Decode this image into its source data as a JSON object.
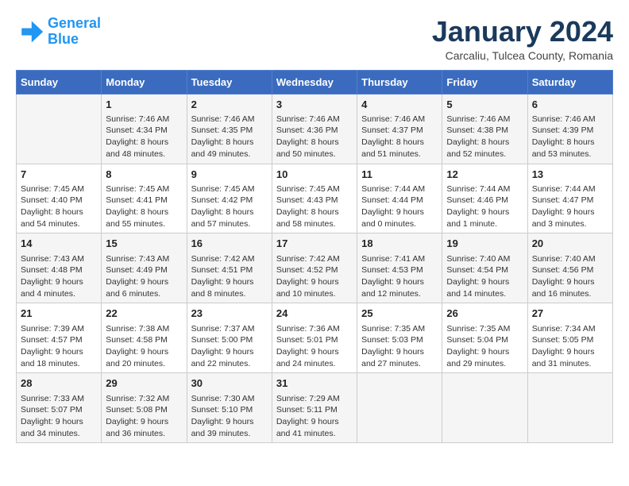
{
  "header": {
    "logo_line1": "General",
    "logo_line2": "Blue",
    "month_title": "January 2024",
    "location": "Carcaliu, Tulcea County, Romania"
  },
  "weekdays": [
    "Sunday",
    "Monday",
    "Tuesday",
    "Wednesday",
    "Thursday",
    "Friday",
    "Saturday"
  ],
  "weeks": [
    [
      {
        "day": "",
        "info": ""
      },
      {
        "day": "1",
        "info": "Sunrise: 7:46 AM\nSunset: 4:34 PM\nDaylight: 8 hours\nand 48 minutes."
      },
      {
        "day": "2",
        "info": "Sunrise: 7:46 AM\nSunset: 4:35 PM\nDaylight: 8 hours\nand 49 minutes."
      },
      {
        "day": "3",
        "info": "Sunrise: 7:46 AM\nSunset: 4:36 PM\nDaylight: 8 hours\nand 50 minutes."
      },
      {
        "day": "4",
        "info": "Sunrise: 7:46 AM\nSunset: 4:37 PM\nDaylight: 8 hours\nand 51 minutes."
      },
      {
        "day": "5",
        "info": "Sunrise: 7:46 AM\nSunset: 4:38 PM\nDaylight: 8 hours\nand 52 minutes."
      },
      {
        "day": "6",
        "info": "Sunrise: 7:46 AM\nSunset: 4:39 PM\nDaylight: 8 hours\nand 53 minutes."
      }
    ],
    [
      {
        "day": "7",
        "info": "Sunrise: 7:45 AM\nSunset: 4:40 PM\nDaylight: 8 hours\nand 54 minutes."
      },
      {
        "day": "8",
        "info": "Sunrise: 7:45 AM\nSunset: 4:41 PM\nDaylight: 8 hours\nand 55 minutes."
      },
      {
        "day": "9",
        "info": "Sunrise: 7:45 AM\nSunset: 4:42 PM\nDaylight: 8 hours\nand 57 minutes."
      },
      {
        "day": "10",
        "info": "Sunrise: 7:45 AM\nSunset: 4:43 PM\nDaylight: 8 hours\nand 58 minutes."
      },
      {
        "day": "11",
        "info": "Sunrise: 7:44 AM\nSunset: 4:44 PM\nDaylight: 9 hours\nand 0 minutes."
      },
      {
        "day": "12",
        "info": "Sunrise: 7:44 AM\nSunset: 4:46 PM\nDaylight: 9 hours\nand 1 minute."
      },
      {
        "day": "13",
        "info": "Sunrise: 7:44 AM\nSunset: 4:47 PM\nDaylight: 9 hours\nand 3 minutes."
      }
    ],
    [
      {
        "day": "14",
        "info": "Sunrise: 7:43 AM\nSunset: 4:48 PM\nDaylight: 9 hours\nand 4 minutes."
      },
      {
        "day": "15",
        "info": "Sunrise: 7:43 AM\nSunset: 4:49 PM\nDaylight: 9 hours\nand 6 minutes."
      },
      {
        "day": "16",
        "info": "Sunrise: 7:42 AM\nSunset: 4:51 PM\nDaylight: 9 hours\nand 8 minutes."
      },
      {
        "day": "17",
        "info": "Sunrise: 7:42 AM\nSunset: 4:52 PM\nDaylight: 9 hours\nand 10 minutes."
      },
      {
        "day": "18",
        "info": "Sunrise: 7:41 AM\nSunset: 4:53 PM\nDaylight: 9 hours\nand 12 minutes."
      },
      {
        "day": "19",
        "info": "Sunrise: 7:40 AM\nSunset: 4:54 PM\nDaylight: 9 hours\nand 14 minutes."
      },
      {
        "day": "20",
        "info": "Sunrise: 7:40 AM\nSunset: 4:56 PM\nDaylight: 9 hours\nand 16 minutes."
      }
    ],
    [
      {
        "day": "21",
        "info": "Sunrise: 7:39 AM\nSunset: 4:57 PM\nDaylight: 9 hours\nand 18 minutes."
      },
      {
        "day": "22",
        "info": "Sunrise: 7:38 AM\nSunset: 4:58 PM\nDaylight: 9 hours\nand 20 minutes."
      },
      {
        "day": "23",
        "info": "Sunrise: 7:37 AM\nSunset: 5:00 PM\nDaylight: 9 hours\nand 22 minutes."
      },
      {
        "day": "24",
        "info": "Sunrise: 7:36 AM\nSunset: 5:01 PM\nDaylight: 9 hours\nand 24 minutes."
      },
      {
        "day": "25",
        "info": "Sunrise: 7:35 AM\nSunset: 5:03 PM\nDaylight: 9 hours\nand 27 minutes."
      },
      {
        "day": "26",
        "info": "Sunrise: 7:35 AM\nSunset: 5:04 PM\nDaylight: 9 hours\nand 29 minutes."
      },
      {
        "day": "27",
        "info": "Sunrise: 7:34 AM\nSunset: 5:05 PM\nDaylight: 9 hours\nand 31 minutes."
      }
    ],
    [
      {
        "day": "28",
        "info": "Sunrise: 7:33 AM\nSunset: 5:07 PM\nDaylight: 9 hours\nand 34 minutes."
      },
      {
        "day": "29",
        "info": "Sunrise: 7:32 AM\nSunset: 5:08 PM\nDaylight: 9 hours\nand 36 minutes."
      },
      {
        "day": "30",
        "info": "Sunrise: 7:30 AM\nSunset: 5:10 PM\nDaylight: 9 hours\nand 39 minutes."
      },
      {
        "day": "31",
        "info": "Sunrise: 7:29 AM\nSunset: 5:11 PM\nDaylight: 9 hours\nand 41 minutes."
      },
      {
        "day": "",
        "info": ""
      },
      {
        "day": "",
        "info": ""
      },
      {
        "day": "",
        "info": ""
      }
    ]
  ]
}
